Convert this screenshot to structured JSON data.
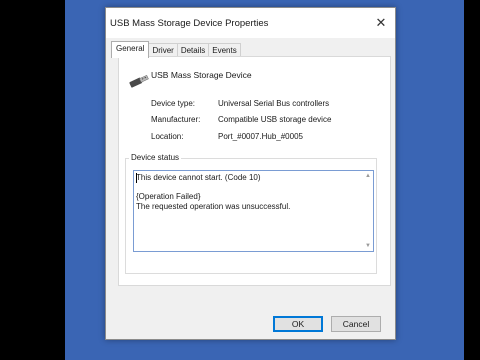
{
  "window": {
    "title": "USB Mass Storage Device Properties",
    "close_glyph": "✕"
  },
  "tabs": [
    {
      "label": "General",
      "active": true
    },
    {
      "label": "Driver",
      "active": false
    },
    {
      "label": "Details",
      "active": false
    },
    {
      "label": "Events",
      "active": false
    }
  ],
  "general": {
    "device_name": "USB Mass Storage Device",
    "device_icon": "usb-plug-icon",
    "properties": [
      {
        "label": "Device type:",
        "value": "Universal Serial Bus controllers"
      },
      {
        "label": "Manufacturer:",
        "value": "Compatible USB storage device"
      },
      {
        "label": "Location:",
        "value": "Port_#0007.Hub_#0005"
      }
    ],
    "status_group_label": "Device status",
    "status_lines": [
      "This device cannot start. (Code 10)",
      "",
      "{Operation Failed}",
      "The requested operation was unsuccessful."
    ]
  },
  "buttons": {
    "ok": "OK",
    "cancel": "Cancel"
  },
  "colors": {
    "desktop": "#3a65b4",
    "focus_border": "#0078d7"
  }
}
